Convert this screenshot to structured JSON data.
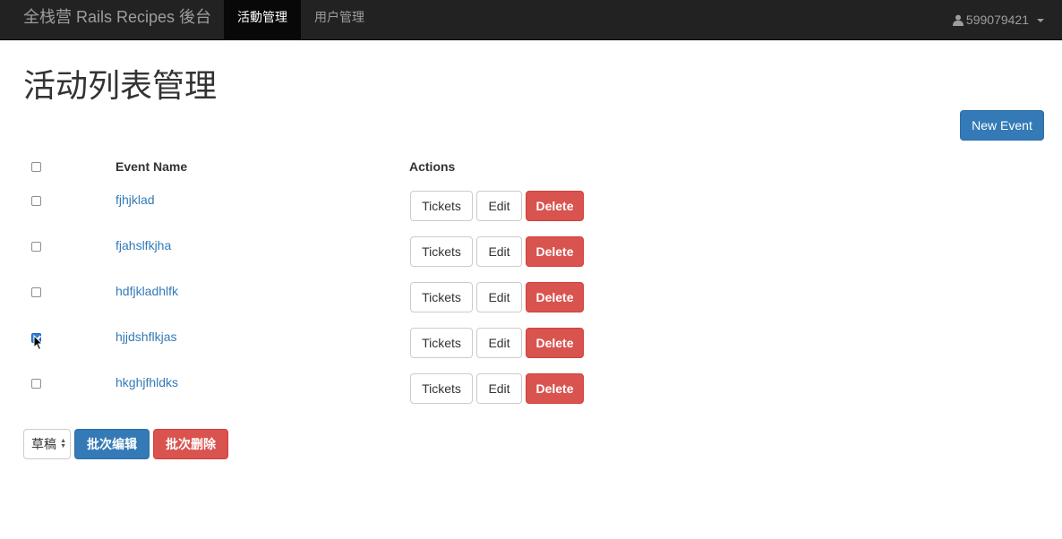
{
  "navbar": {
    "brand": "全栈营 Rails Recipes 後台",
    "items": [
      {
        "label": "活動管理",
        "active": true
      },
      {
        "label": "用户管理",
        "active": false
      }
    ],
    "user": {
      "icon": "user-icon",
      "name": "599079421"
    }
  },
  "page": {
    "title": "活动列表管理",
    "new_event_label": "New Event"
  },
  "table": {
    "headers": {
      "name": "Event Name",
      "actions": "Actions"
    },
    "rows": [
      {
        "name": "fjhjklad",
        "checked": false
      },
      {
        "name": "fjahslfkjha",
        "checked": false
      },
      {
        "name": "hdfjkladhlfk",
        "checked": false
      },
      {
        "name": "hjjdshflkjas",
        "checked": true
      },
      {
        "name": "hkghjfhldks",
        "checked": false
      }
    ],
    "action_labels": {
      "tickets": "Tickets",
      "edit": "Edit",
      "delete": "Delete"
    }
  },
  "batch": {
    "status_select": {
      "selected": "草稿"
    },
    "edit_label": "批次编辑",
    "delete_label": "批次删除"
  },
  "colors": {
    "navbar_bg": "#222222",
    "primary": "#337ab7",
    "danger": "#d9534f",
    "link": "#337ab7"
  }
}
